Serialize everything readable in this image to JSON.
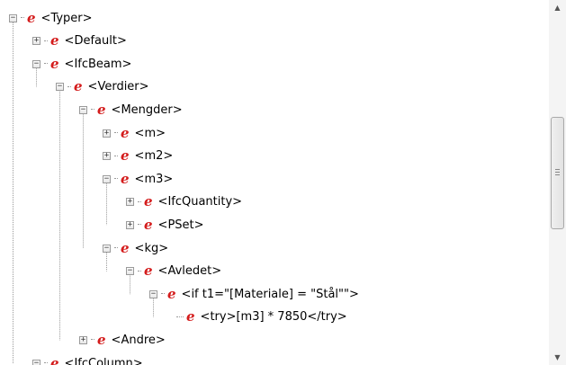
{
  "tree": {
    "nodes": [
      {
        "label": "<Typer>",
        "level": 0,
        "toggle": "minus"
      },
      {
        "label": "<Default>",
        "level": 1,
        "toggle": "plus"
      },
      {
        "label": "<IfcBeam>",
        "level": 1,
        "toggle": "minus"
      },
      {
        "label": "<Verdier>",
        "level": 2,
        "toggle": "minus"
      },
      {
        "label": "<Mengder>",
        "level": 3,
        "toggle": "minus"
      },
      {
        "label": "<m>",
        "level": 4,
        "toggle": "plus"
      },
      {
        "label": "<m2>",
        "level": 4,
        "toggle": "plus"
      },
      {
        "label": "<m3>",
        "level": 4,
        "toggle": "minus"
      },
      {
        "label": "<IfcQuantity>",
        "level": 5,
        "toggle": "plus"
      },
      {
        "label": "<PSet>",
        "level": 5,
        "toggle": "plus"
      },
      {
        "label": "<kg>",
        "level": 4,
        "toggle": "minus"
      },
      {
        "label": "<Avledet>",
        "level": 5,
        "toggle": "minus"
      },
      {
        "label": "<if t1=\"[Materiale] = \"Stål\"\">",
        "level": 6,
        "toggle": "minus"
      },
      {
        "label": "<try>[m3] * 7850</try>",
        "level": 7,
        "toggle": "none"
      },
      {
        "label": "<Andre>",
        "level": 3,
        "toggle": "plus"
      },
      {
        "label": "<IfcColumn>",
        "level": 1,
        "toggle": "minus"
      }
    ],
    "element_icon": "element-e-icon",
    "icon_color": "#d41c1c"
  },
  "scrollbar": {
    "up_icon": "scroll-up-arrow-icon",
    "down_icon": "scroll-down-arrow-icon"
  }
}
